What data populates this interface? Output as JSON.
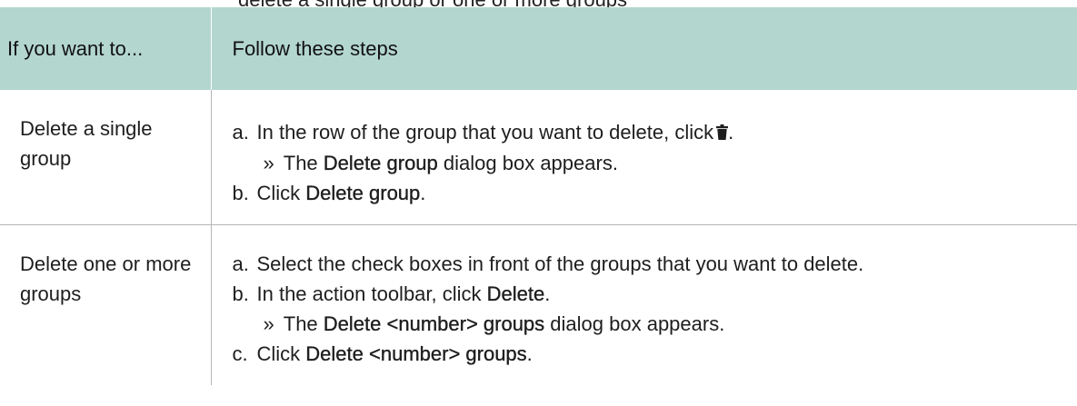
{
  "partial_top_text": "delete a single group or one or more groups",
  "table": {
    "headers": [
      "If you want to...",
      "Follow these steps"
    ],
    "rows": [
      {
        "action": "Delete a single group",
        "steps": [
          {
            "mark": "a.",
            "prefix": "In the row of the group that you want to delete, click",
            "icon": "trash-icon",
            "suffix": "."
          },
          {
            "result_mark": "»",
            "prefix": "The",
            "ui": "Delete group",
            "suffix": "dialog box appears."
          },
          {
            "mark": "b.",
            "prefix": "Click",
            "ui": "Delete group",
            "suffix": "."
          }
        ]
      },
      {
        "action": "Delete one or more groups",
        "steps": [
          {
            "mark": "a.",
            "text": "Select the check boxes in front of the groups that you want to delete."
          },
          {
            "mark": "b.",
            "prefix": "In the action toolbar, click",
            "ui": "Delete",
            "suffix": "."
          },
          {
            "result_mark": "»",
            "prefix": "The",
            "ui": "Delete <number> groups",
            "suffix": "dialog box appears."
          },
          {
            "mark": "c.",
            "prefix": "Click",
            "ui": "Delete <number> groups",
            "suffix": "."
          }
        ]
      }
    ]
  },
  "colors": {
    "header_bg": "#b3d6cf",
    "border": "#b5b5b5",
    "text": "#1e1e1e"
  }
}
